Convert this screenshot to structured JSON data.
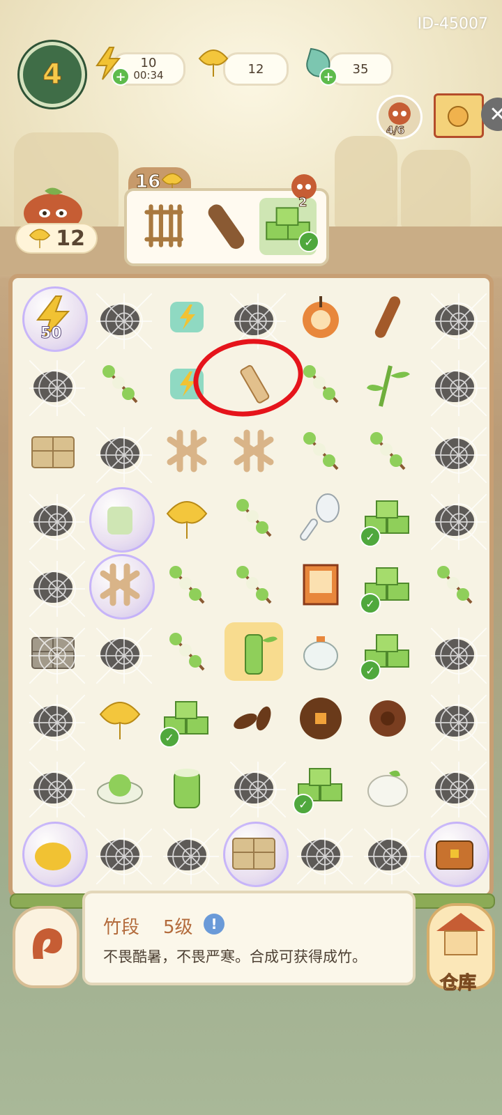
{
  "header": {
    "user_id": "ID-45007",
    "level": "4",
    "energy": {
      "value": "10",
      "timer": "00:34",
      "icon": "lightning-icon"
    },
    "leaves": {
      "value": "12",
      "icon": "ginkgo-leaf-icon"
    },
    "drops": {
      "value": "35",
      "icon": "water-drop-icon"
    },
    "panda_helpers": "4/6"
  },
  "order": {
    "reward": "16",
    "customer_count": "2",
    "items": [
      "bamboo-mat",
      "wood-log",
      "green-tofu-stack"
    ]
  },
  "player": {
    "leaf_count": "12"
  },
  "board": {
    "bubble_value": "50",
    "rows": [
      [
        "energy-bubble",
        "bowl-webbed",
        "energy-card",
        "branch-webbed",
        "bread",
        "wood-stick",
        "stone-webbed"
      ],
      [
        "sticks-webbed",
        "dango",
        "energy-card-small",
        "bamboo-piece",
        "dango",
        "bamboo-sprout",
        "rock-webbed"
      ],
      [
        "box",
        "rock-webbed",
        "lattice",
        "lattice",
        "dango",
        "dango",
        "pot-webbed"
      ],
      [
        "leaf-webbed",
        "cup-bubble",
        "ginkgo-leaf",
        "dango",
        "spoon",
        "tofu-checked",
        "owl-webbed"
      ],
      [
        "pile-webbed",
        "lattice-bubble",
        "dango",
        "dango",
        "lantern-box",
        "tofu-checked",
        "dango"
      ],
      [
        "box-webbed",
        "bush-webbed",
        "dango",
        "bamboo-highlight",
        "teapot",
        "tofu-checked",
        "animal-webbed"
      ],
      [
        "log-webbed",
        "ginkgo-leaf",
        "tofu-checked",
        "seeds",
        "pie",
        "flower-brown",
        "rock-webbed"
      ],
      [
        "tool-webbed",
        "green-dish",
        "bamboo-cup",
        "purple-leaf-webbed",
        "tofu-checked",
        "mochi",
        "stone-webbed"
      ],
      [
        "frog-bubble",
        "pinecone-webbed",
        "fruit-webbed",
        "box-bubble",
        "mound-webbed",
        "herb-webbed",
        "chest-bubble"
      ]
    ]
  },
  "item_info": {
    "name": "竹段",
    "level": "5级",
    "description": "不畏酷暑，不畏严寒。合成可获得成竹。"
  },
  "buttons": {
    "warehouse": "仓库"
  },
  "colors": {
    "accent_green": "#4fa83d",
    "highlight_red": "#e5141b",
    "gold": "#f1c233"
  }
}
